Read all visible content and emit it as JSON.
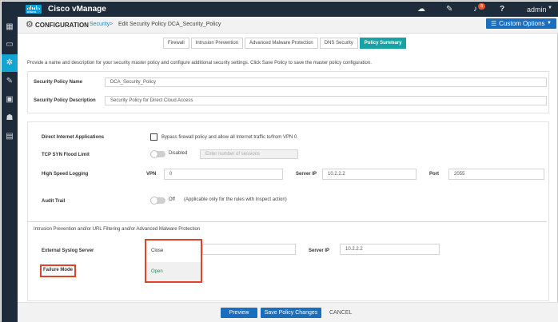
{
  "topbar": {
    "logo_text": "cisco",
    "app_name": "Cisco vManage",
    "icons": [
      "cloud-icon",
      "wrench-icon",
      "bell-icon",
      "help-icon"
    ],
    "notification_count": "8",
    "user": "admin"
  },
  "sidebar": {
    "items": [
      {
        "icon": "dashboard-icon"
      },
      {
        "icon": "monitor-icon"
      },
      {
        "icon": "configuration-icon",
        "active": true
      },
      {
        "icon": "tools-icon"
      },
      {
        "icon": "maintenance-icon"
      },
      {
        "icon": "administration-icon"
      },
      {
        "icon": "analytics-icon"
      }
    ]
  },
  "header": {
    "title": "CONFIGURATION",
    "breadcrumb_link": "Security",
    "breadcrumb_separator": ">",
    "breadcrumb_current": "Edit Security Policy DCA_Security_Policy",
    "custom_options_label": "Custom Options"
  },
  "tabs": [
    {
      "label": "Firewall",
      "active": false
    },
    {
      "label": "Intrusion Prevention",
      "active": false
    },
    {
      "label": "Advanced Malware Protection",
      "active": false
    },
    {
      "label": "DNS Security",
      "active": false
    },
    {
      "label": "Policy Summary",
      "active": true
    }
  ],
  "intro_text": "Provide a name and description for your security master policy and configure additional security settings. Click Save Policy to save the master policy configuration.",
  "policy": {
    "name_label": "Security Policy Name",
    "name_value": "DCA_Security_Policy",
    "description_label": "Security Policy Description",
    "description_value": "Security Policy for Direct Cloud Access"
  },
  "settings": {
    "dia_label": "Direct Internet Applications",
    "dia_checkbox_label": "Bypass firewall policy and allow all Internet traffic to/from VPN 0",
    "tcp_label": "TCP SYN Flood Limit",
    "tcp_toggle_label": "Disabled",
    "tcp_placeholder": "Enter number of sessions",
    "hsl_label": "High Speed Logging",
    "vpn_label": "VPN",
    "vpn_value": "0",
    "server_ip_label": "Server IP",
    "server_ip_value": "10.2.2.2",
    "port_label": "Port",
    "port_value": "2055",
    "audit_label": "Audit Trail",
    "audit_toggle_label": "Off",
    "audit_note": "(Applicable only for the rules with Inspect action)",
    "ips_section_title": "Intrusion Prevention and/or URL Filtering and/or Advanced Malware Protection",
    "syslog_label": "External Syslog Server",
    "syslog_server_ip_label": "Server IP",
    "syslog_server_ip_value": "10.2.2.2",
    "failure_mode_label": "Failure Mode"
  },
  "failure_mode_dropdown": {
    "options": [
      "Close",
      "Open"
    ],
    "selected": "Open"
  },
  "footer": {
    "preview_label": "Preview",
    "save_label": "Save Policy Changes",
    "cancel_label": "CANCEL"
  },
  "colors": {
    "nav_bg": "#1d2b3a",
    "accent_blue": "#1a6ebd",
    "active_tab": "#17a3a3",
    "highlight_red": "#e0432a",
    "sidebar_active": "#12a5d2"
  }
}
